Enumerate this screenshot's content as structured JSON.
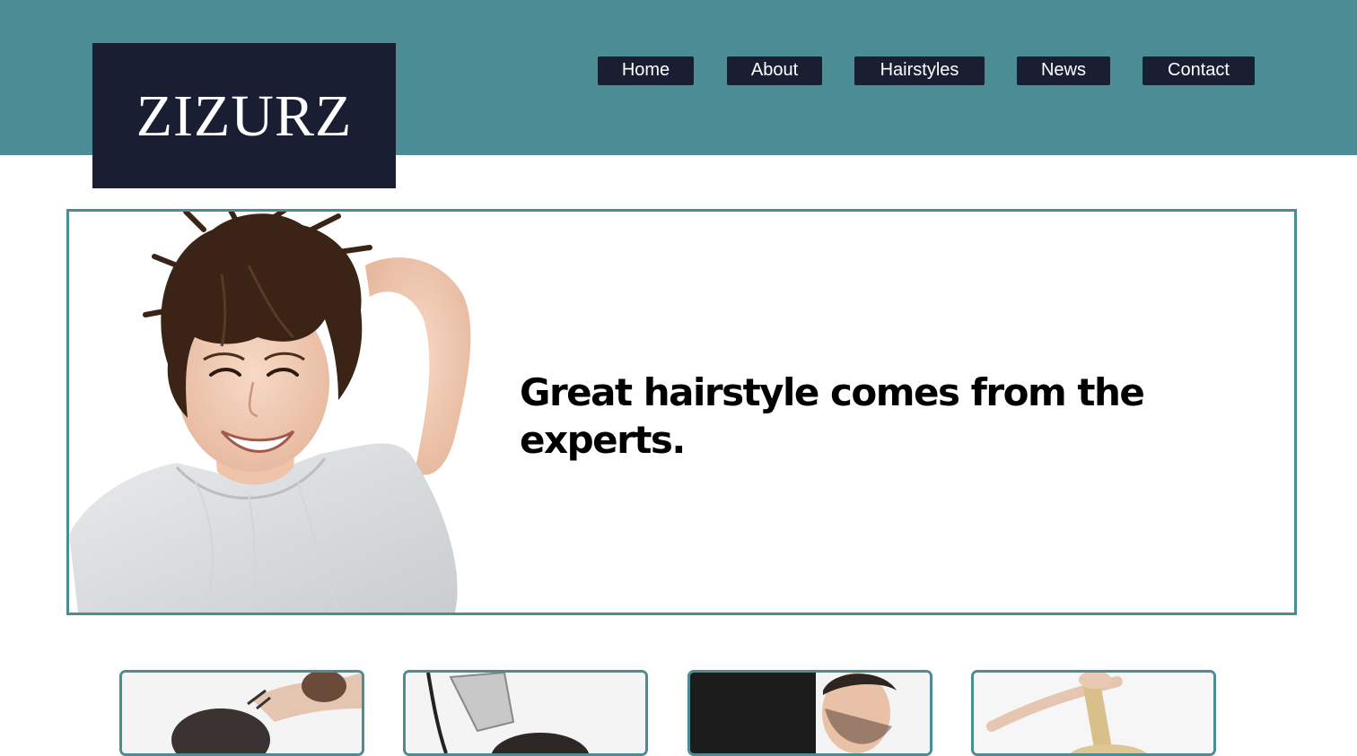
{
  "site": {
    "logo_text": "ZIZURZ"
  },
  "nav": {
    "items": [
      {
        "label": "Home"
      },
      {
        "label": "About"
      },
      {
        "label": "Hairstyles"
      },
      {
        "label": "News"
      },
      {
        "label": "Contact"
      }
    ]
  },
  "hero": {
    "headline": "Great hairstyle comes from the experts.",
    "image": "smiling-woman-short-hair-photo"
  },
  "cards": [
    {
      "image": "barber-scissor-cut-photo"
    },
    {
      "image": "clipper-haircut-photo"
    },
    {
      "image": "stylist-man-photo"
    },
    {
      "image": "blonde-hair-strand-photo"
    }
  ],
  "colors": {
    "header_teal": "#4c8c95",
    "navy": "#1a1e33",
    "white": "#ffffff",
    "text": "#000000"
  }
}
